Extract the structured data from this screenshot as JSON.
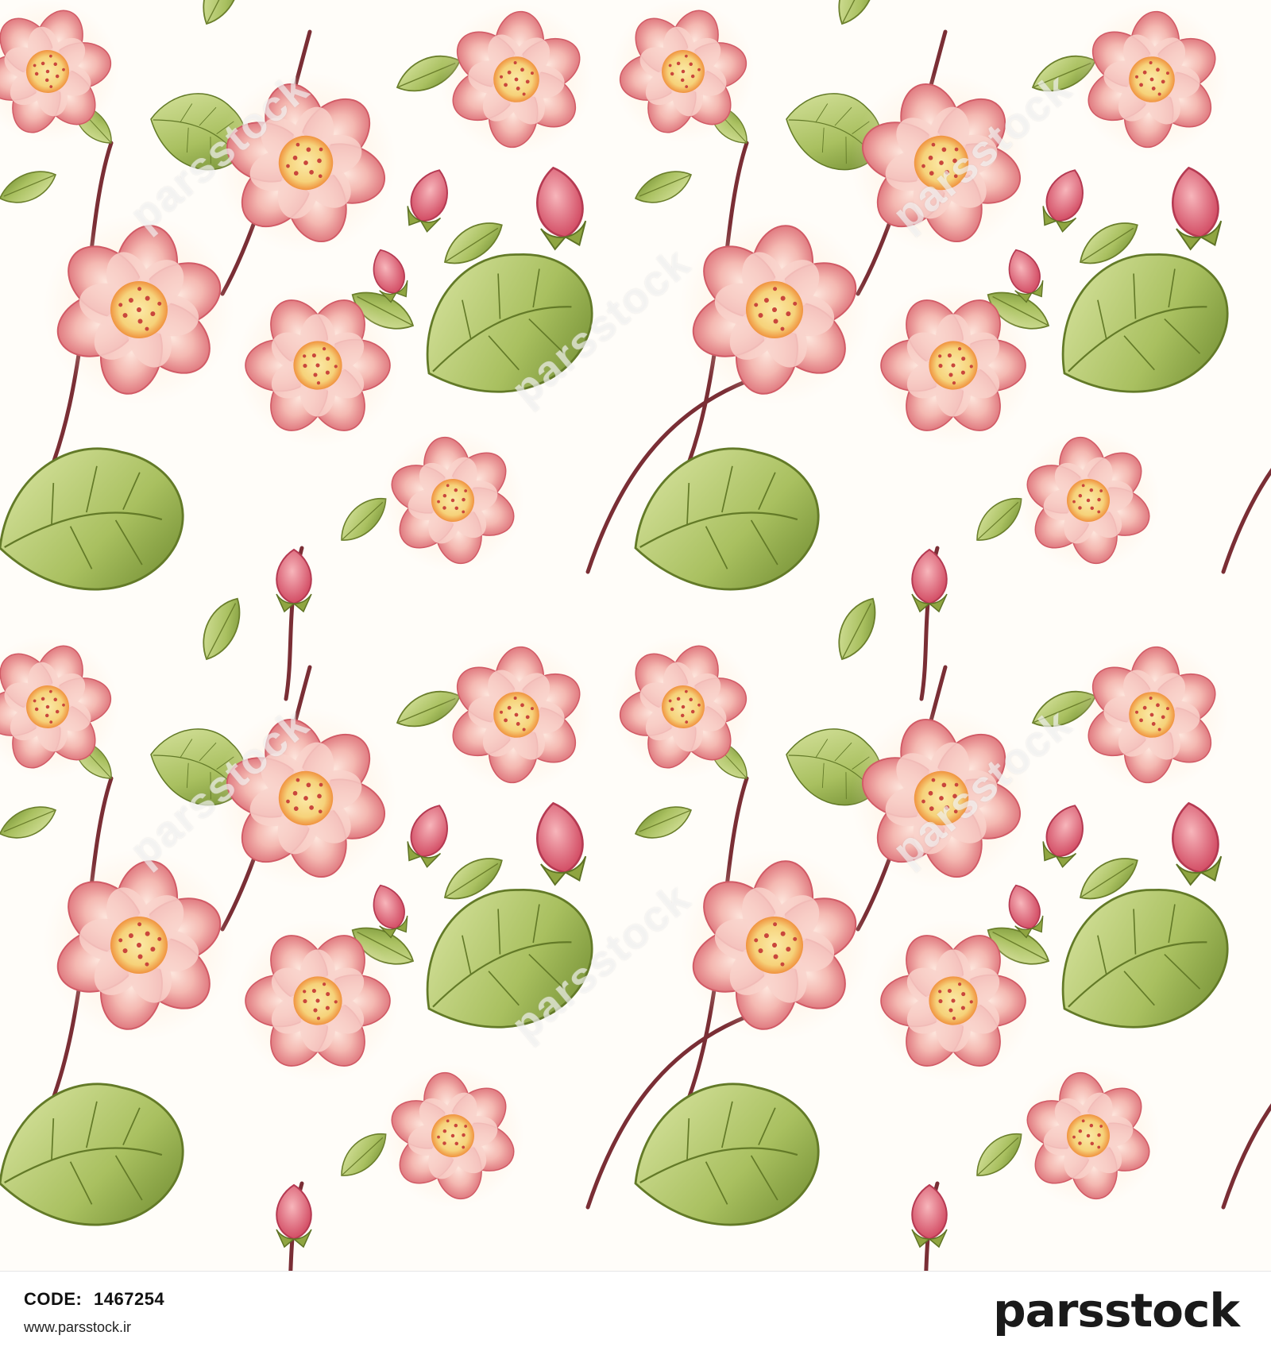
{
  "pattern": {
    "watermark_text": "parsstock",
    "colors": {
      "background": "#fffdf9",
      "petal_light": "#f8c9c2",
      "petal_mid": "#ee9f9a",
      "petal_dark": "#d9545f",
      "center": "#f6da84",
      "center_ring": "#f39a4a",
      "leaf_light": "#c9d98a",
      "leaf_dark": "#7f9a3a",
      "stem": "#7a2e35"
    }
  },
  "footer": {
    "code_label": "CODE:",
    "code_value": "1467254",
    "url": "www.parsstock.ir",
    "logo": "parsstock"
  }
}
